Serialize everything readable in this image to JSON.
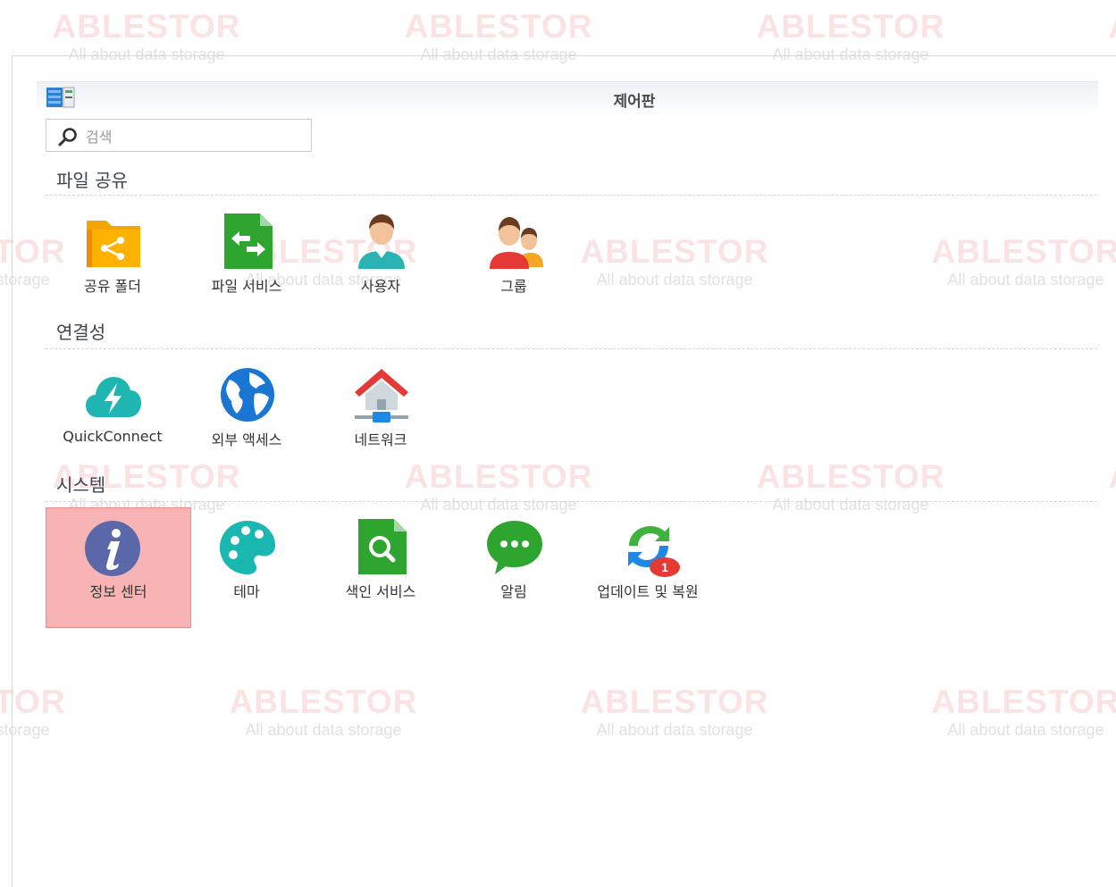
{
  "watermark": {
    "brand": "ABLESTOR",
    "tagline": "All about data storage"
  },
  "window": {
    "title": "제어판"
  },
  "search": {
    "placeholder": "검색"
  },
  "sections": [
    {
      "title": "파일 공유",
      "items": [
        {
          "label": "공유 폴더",
          "icon": "shared-folder-icon"
        },
        {
          "label": "파일 서비스",
          "icon": "file-services-icon"
        },
        {
          "label": "사용자",
          "icon": "user-icon"
        },
        {
          "label": "그룹",
          "icon": "group-icon"
        }
      ]
    },
    {
      "title": "연결성",
      "items": [
        {
          "label": "QuickConnect",
          "icon": "quickconnect-icon"
        },
        {
          "label": "외부 액세스",
          "icon": "globe-icon"
        },
        {
          "label": "네트워크",
          "icon": "network-icon"
        }
      ]
    },
    {
      "title": "시스템",
      "items": [
        {
          "label": "정보 센터",
          "icon": "info-icon",
          "selected": true
        },
        {
          "label": "테마",
          "icon": "palette-icon"
        },
        {
          "label": "색인 서비스",
          "icon": "indexing-icon"
        },
        {
          "label": "알림",
          "icon": "notification-icon"
        },
        {
          "label": "업데이트 및 복원",
          "icon": "update-icon",
          "badge": "1"
        }
      ]
    }
  ],
  "colors": {
    "selected_bg": "#f8b4b4",
    "badge": "#e53935"
  }
}
